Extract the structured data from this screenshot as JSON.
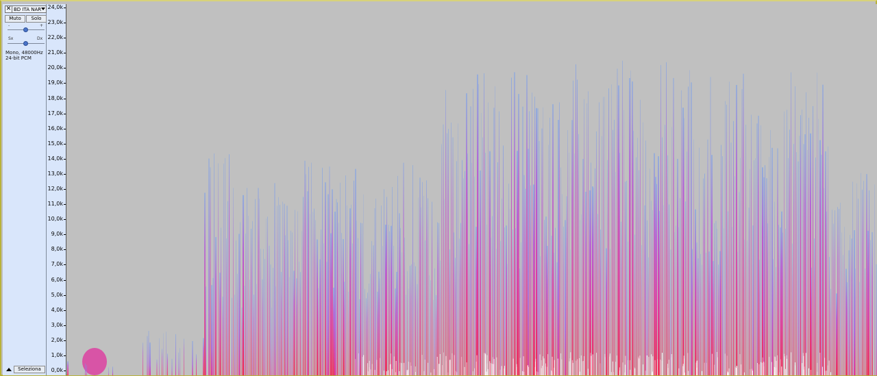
{
  "track": {
    "close_glyph": "✕",
    "name": "BD ITA NAR",
    "mute_label": "Muto",
    "solo_label": "Solo",
    "gain_minus": "-",
    "gain_plus": "+",
    "pan_left": "Sx",
    "pan_right": "Dx",
    "format_line1": "Mono, 48000Hz",
    "format_line2": "24-bit PCM",
    "select_label": "Seleziona"
  },
  "ruler": {
    "labels": [
      "24,0k",
      "23,0k",
      "22,0k",
      "21,0k",
      "20,0k",
      "19,0k",
      "18,0k",
      "17,0k",
      "16,0k",
      "15,0k",
      "14,0k",
      "13,0k",
      "12,0k",
      "11,0k",
      "10,0k",
      "9,0k",
      "8,0k",
      "7,0k",
      "6,0k",
      "5,0k",
      "4,0k",
      "3,0k",
      "2,0k",
      "1,0k",
      "0,0k"
    ]
  },
  "colors": {
    "background": "#c0c0c0",
    "low_energy": "#6f9cf0",
    "mid_energy": "#e0309e",
    "high_energy": "#f21e4a",
    "peak": "#ffffff",
    "panel": "#d9e6fb"
  },
  "icons": {
    "close": "close-icon",
    "dropdown": "chevron-down-icon",
    "collapse": "collapse-up-icon"
  }
}
